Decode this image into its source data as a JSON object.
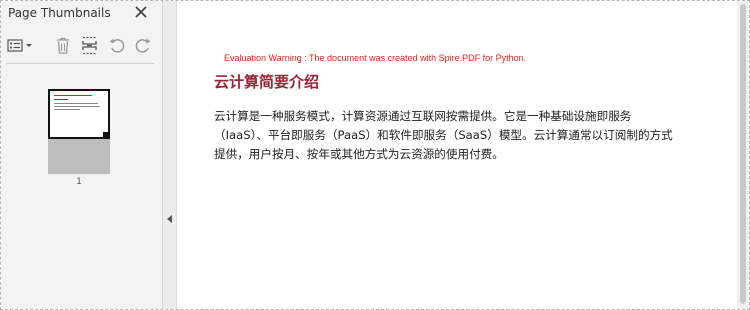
{
  "sidebar": {
    "title": "Page Thumbnails",
    "thumbnails": [
      {
        "page_number": "1"
      }
    ]
  },
  "toolbar": {
    "icons": [
      "thumbnail-options-icon",
      "delete-page-icon",
      "insert-page-icon",
      "rotate-left-icon",
      "rotate-right-icon"
    ]
  },
  "document": {
    "warning": "Evaluation Warning : The document was created with Spire.PDF for Python.",
    "title": "云计算简要介绍",
    "paragraph_lines": [
      "云计算是一种服务模式，计算资源通过互联网按需提供。它是一种基础设施即服务",
      "（IaaS）、平台即服务（PaaS）和软件即服务（SaaS）模型。云计算通常以订阅制的方式",
      "提供，用户按月、按年或其他方式为云资源的使用付费。"
    ]
  },
  "colors": {
    "warning_text": "#e8211c",
    "title_text": "#9b2335",
    "panel_background": "#f3f3f3"
  }
}
